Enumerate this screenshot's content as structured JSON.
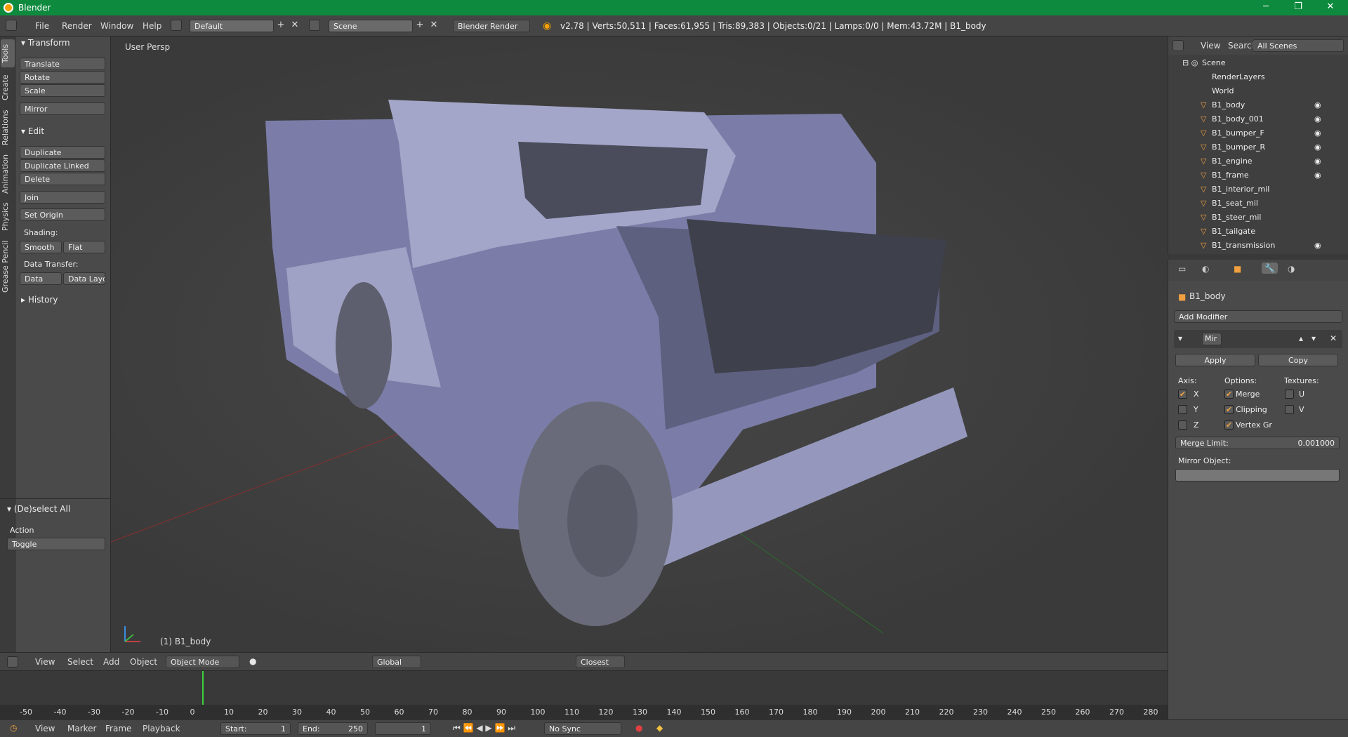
{
  "window": {
    "title": "Blender"
  },
  "topbar": {
    "menus": [
      "File",
      "Render",
      "Window",
      "Help"
    ],
    "layout": "Default",
    "scene": "Scene",
    "engine": "Blender Render",
    "stats": "v2.78 | Verts:50,511 | Faces:61,955 | Tris:89,383 | Objects:0/21 | Lamps:0/0 | Mem:43.72M | B1_body"
  },
  "sidetabs": [
    "Tools",
    "Create",
    "Relations",
    "Animation",
    "Physics",
    "Grease Pencil"
  ],
  "tools": {
    "transform": "Transform",
    "translate": "Translate",
    "rotate": "Rotate",
    "scale": "Scale",
    "mirror": "Mirror",
    "edit": "Edit",
    "duplicate": "Duplicate",
    "duplicate_linked": "Duplicate Linked",
    "delete": "Delete",
    "join": "Join",
    "set_origin": "Set Origin",
    "shading": "Shading:",
    "smooth": "Smooth",
    "flat": "Flat",
    "data_transfer": "Data Transfer:",
    "data": "Data",
    "data_layo": "Data Layo",
    "history": "History",
    "deselect": "(De)select All",
    "action": "Action",
    "toggle": "Toggle"
  },
  "viewport": {
    "label": "User Persp",
    "object": "(1) B1_body"
  },
  "outliner": {
    "menus": [
      "View",
      "Search"
    ],
    "filter": "All Scenes",
    "scene": "Scene",
    "items": [
      "RenderLayers",
      "World",
      "B1_body",
      "B1_body_001",
      "B1_bumper_F",
      "B1_bumper_R",
      "B1_engine",
      "B1_frame",
      "B1_interior_mil",
      "B1_seat_mil",
      "B1_steer_mil",
      "B1_tailgate",
      "B1_transmission"
    ]
  },
  "properties": {
    "object": "B1_body",
    "add_modifier": "Add Modifier",
    "modifier_name": "Mir",
    "apply": "Apply",
    "copy": "Copy",
    "axis": "Axis:",
    "options": "Options:",
    "textures": "Textures:",
    "x": "X",
    "y": "Y",
    "z": "Z",
    "merge": "Merge",
    "clipping": "Clipping",
    "vertex_gr": "Vertex Gr",
    "u": "U",
    "v": "V",
    "merge_limit_label": "Merge Limit:",
    "merge_limit": "0.001000",
    "mirror_object": "Mirror Object:"
  },
  "header3d": {
    "menus": [
      "View",
      "Select",
      "Add",
      "Object"
    ],
    "mode": "Object Mode",
    "orientation": "Global",
    "snap": "Closest"
  },
  "timeline": {
    "ticks": [
      "-50",
      "-40",
      "-30",
      "-20",
      "-10",
      "0",
      "10",
      "20",
      "30",
      "40",
      "50",
      "60",
      "70",
      "80",
      "90",
      "100",
      "110",
      "120",
      "130",
      "140",
      "150",
      "160",
      "170",
      "180",
      "190",
      "200",
      "210",
      "220",
      "230",
      "240",
      "250",
      "260",
      "270",
      "280"
    ]
  },
  "footer": {
    "menus": [
      "View",
      "Marker",
      "Frame",
      "Playback"
    ],
    "start_label": "Start:",
    "start": "1",
    "end_label": "End:",
    "end": "250",
    "current": "1",
    "sync": "No Sync"
  }
}
